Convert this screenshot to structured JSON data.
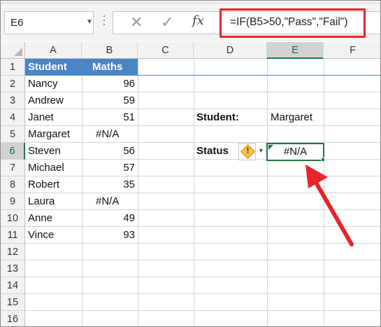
{
  "name_box": {
    "value": "E6",
    "dropdown_icon": "chevron-down-icon"
  },
  "formula_bar": {
    "cancel_icon": "✕",
    "enter_icon": "✓",
    "fx_label": "fx",
    "formula": "=IF(B5>50,\"Pass\",\"Fail\")"
  },
  "columns": [
    "A",
    "B",
    "C",
    "D",
    "E",
    "F"
  ],
  "selected_column": "E",
  "rows": [
    "1",
    "2",
    "3",
    "4",
    "5",
    "6",
    "7",
    "8",
    "9",
    "10",
    "11",
    "12",
    "13",
    "14",
    "15",
    "16"
  ],
  "selected_row": "6",
  "table": {
    "headers": {
      "student": "Student",
      "maths": "Maths"
    },
    "rows": [
      {
        "name": "Nancy",
        "score": "96"
      },
      {
        "name": "Andrew",
        "score": "59"
      },
      {
        "name": "Janet",
        "score": "51"
      },
      {
        "name": "Margaret",
        "score": "#N/A"
      },
      {
        "name": "Steven",
        "score": "56"
      },
      {
        "name": "Michael",
        "score": "57"
      },
      {
        "name": "Robert",
        "score": "35"
      },
      {
        "name": "Laura",
        "score": "#N/A"
      },
      {
        "name": "Anne",
        "score": "49"
      },
      {
        "name": "Vince",
        "score": "93"
      }
    ]
  },
  "lookup": {
    "student_label": "Student:",
    "student_value": "Margaret",
    "status_label": "Status",
    "status_value": "#N/A",
    "error_icon": "warning-icon"
  },
  "colors": {
    "header_fill": "#4a86c7",
    "selection_green": "#217346",
    "callout_red": "#e8242b"
  }
}
